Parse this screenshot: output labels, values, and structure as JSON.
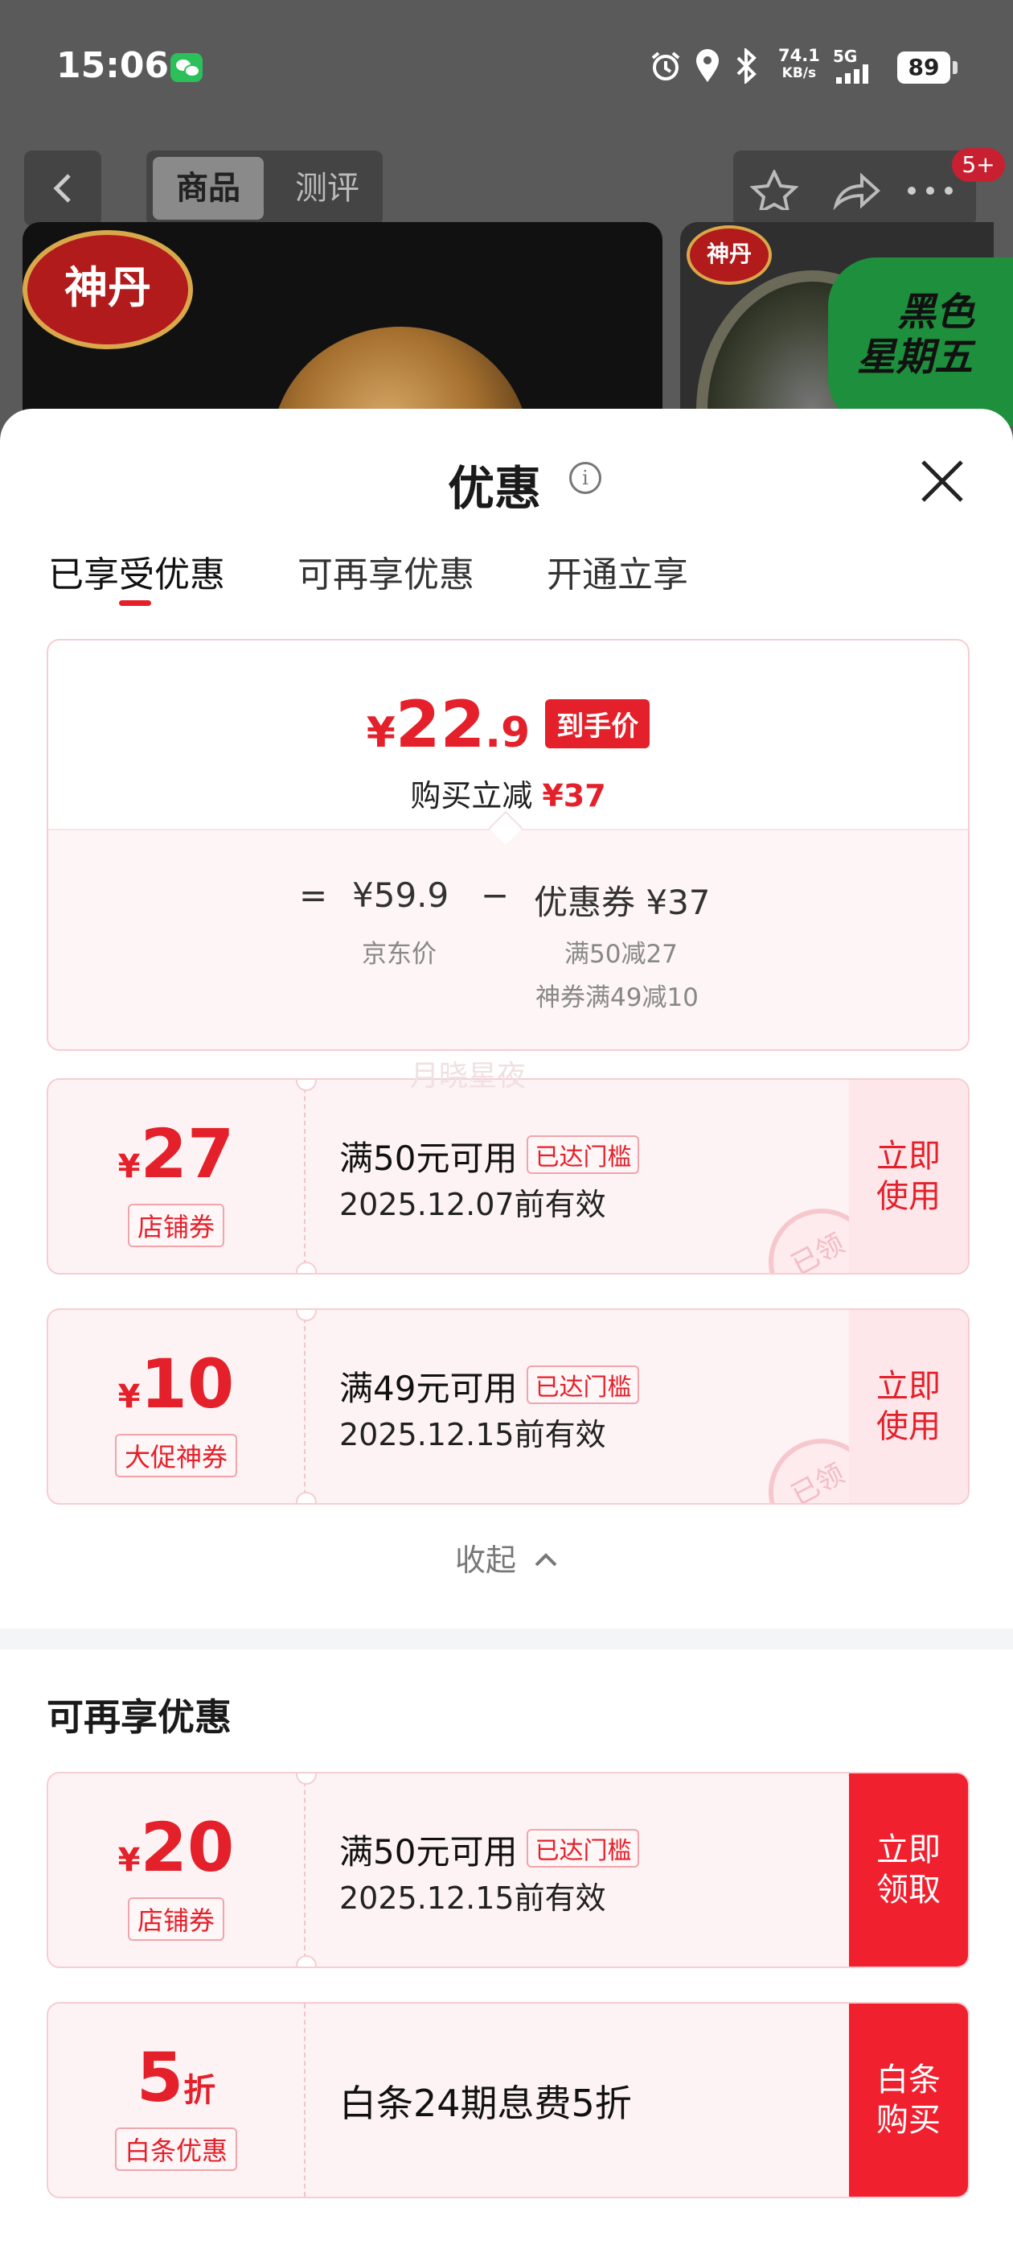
{
  "status_bar": {
    "time": "15:06",
    "net_speed_value": "74.1",
    "net_speed_unit": "KB/s",
    "network": "5G",
    "battery": "89"
  },
  "nav": {
    "tab_product": "商品",
    "tab_review": "测评",
    "notification_badge": "5+"
  },
  "background": {
    "brand_logo": "神丹",
    "promo_banner_line1": "黑色",
    "promo_banner_line2": "星期五"
  },
  "sheet": {
    "title": "优惠",
    "tabs": [
      "已享受优惠",
      "可再享优惠",
      "开通立享"
    ],
    "active_tab": 0
  },
  "summary": {
    "price_symbol": "¥",
    "price_integer": "22",
    "price_decimal": ".9",
    "price_badge": "到手价",
    "reduce_label": "购买立减",
    "reduce_amount": "¥37",
    "equals": "=",
    "jd_price": "¥59.9",
    "jd_price_label": "京东价",
    "minus": "−",
    "coupon_total": "优惠券 ¥37",
    "coupon_detail_1": "满50减27",
    "coupon_detail_2": "神券满49减10"
  },
  "watermark": "月晓星夜",
  "enjoyed_coupons": [
    {
      "symbol": "¥",
      "amount": "27",
      "type": "店铺券",
      "condition": "满50元可用",
      "tag": "已达门槛",
      "expiry": "2025.12.07前有效",
      "button": "立即\n使用",
      "stamp": "已领"
    },
    {
      "symbol": "¥",
      "amount": "10",
      "type": "大促神券",
      "condition": "满49元可用",
      "tag": "已达门槛",
      "expiry": "2025.12.15前有效",
      "button": "立即\n使用",
      "stamp": "已领"
    }
  ],
  "collapse_label": "收起",
  "more_section": {
    "title": "可再享优惠",
    "coupons": [
      {
        "symbol": "¥",
        "amount": "20",
        "type": "店铺券",
        "condition": "满50元可用",
        "tag": "已达门槛",
        "expiry": "2025.12.15前有效",
        "button": "立即\n领取"
      },
      {
        "amount": "5",
        "suffix": "折",
        "type": "白条优惠",
        "description": "白条24期息费5折",
        "button": "白条\n购买"
      }
    ]
  },
  "colors": {
    "accent_red": "#e4202a",
    "card_border": "#f6cdd2",
    "card_bg": "#fdf3f4"
  }
}
